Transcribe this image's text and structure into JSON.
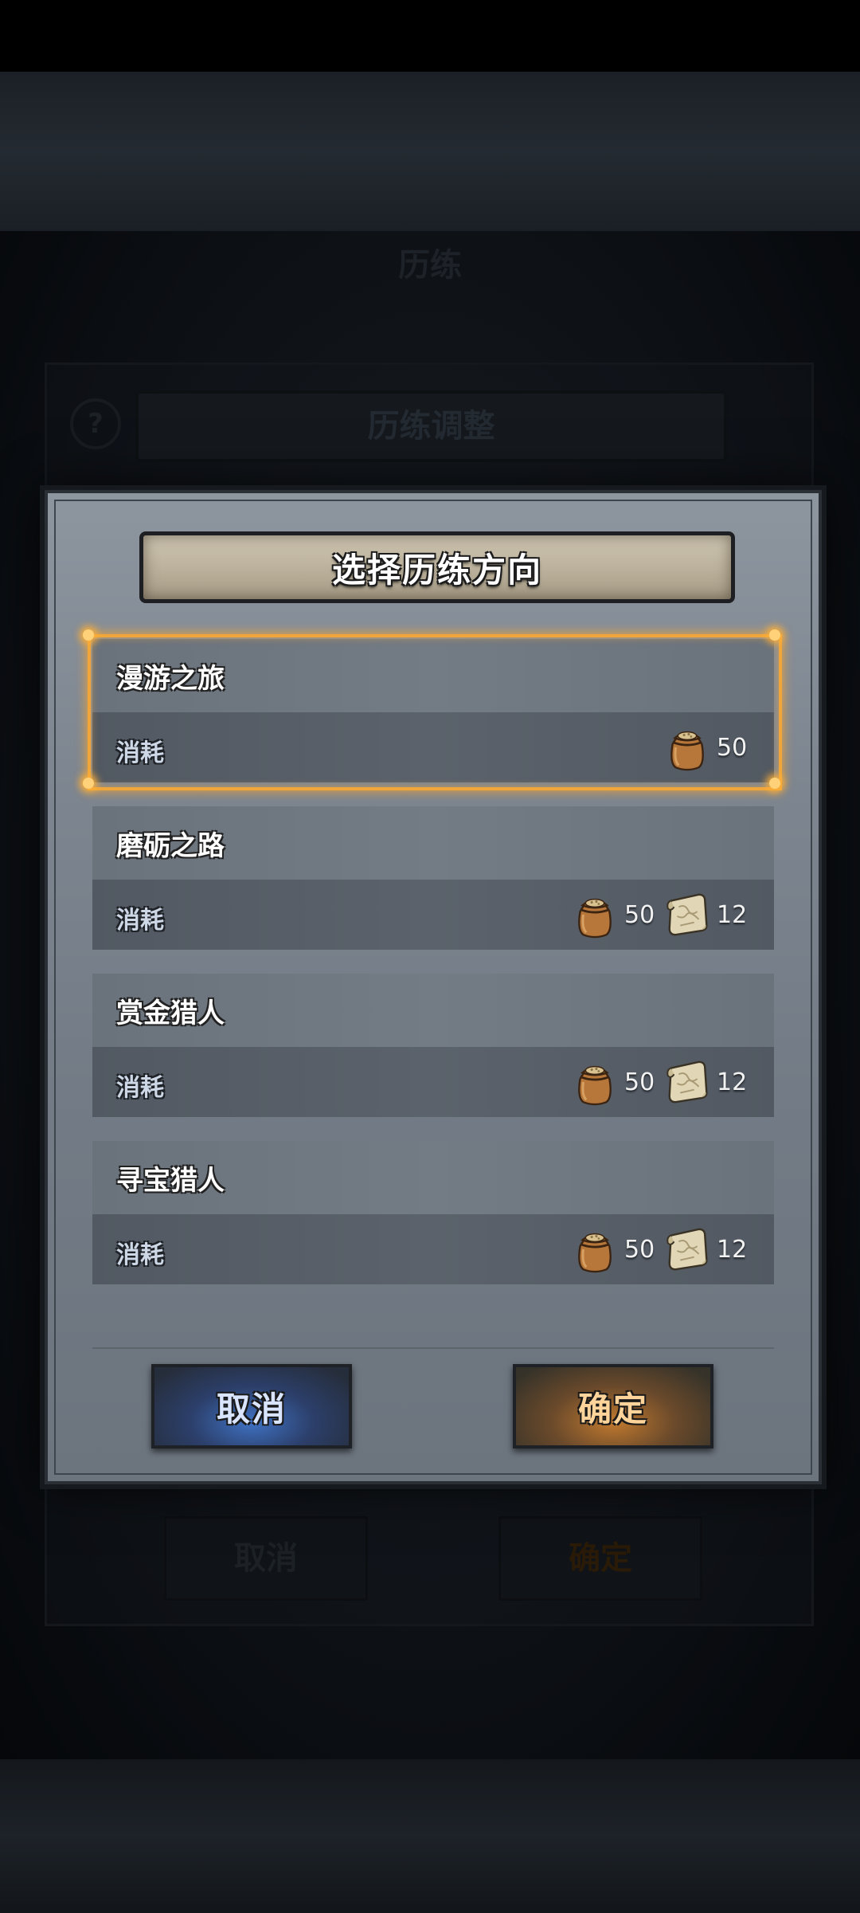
{
  "background": {
    "under_title": "历练",
    "under_panel_title": "历练调整",
    "under_cancel": "取消",
    "under_confirm": "确定"
  },
  "dialog": {
    "title": "选择历练方向",
    "cost_label": "消耗",
    "options": [
      {
        "name": "漫游之旅",
        "selected": true,
        "costs": [
          {
            "icon": "grain-sack-icon",
            "amount": "50"
          }
        ]
      },
      {
        "name": "磨砺之路",
        "selected": false,
        "costs": [
          {
            "icon": "grain-sack-icon",
            "amount": "50"
          },
          {
            "icon": "scroll-map-icon",
            "amount": "12"
          }
        ]
      },
      {
        "name": "赏金猎人",
        "selected": false,
        "costs": [
          {
            "icon": "grain-sack-icon",
            "amount": "50"
          },
          {
            "icon": "scroll-map-icon",
            "amount": "12"
          }
        ]
      },
      {
        "name": "寻宝猎人",
        "selected": false,
        "costs": [
          {
            "icon": "grain-sack-icon",
            "amount": "50"
          },
          {
            "icon": "scroll-map-icon",
            "amount": "12"
          }
        ]
      }
    ],
    "cancel_label": "取消",
    "confirm_label": "确定"
  },
  "colors": {
    "selection_glow": "#f0a63a",
    "cancel_button": "#3f72c4",
    "confirm_button": "#c27a2e"
  }
}
